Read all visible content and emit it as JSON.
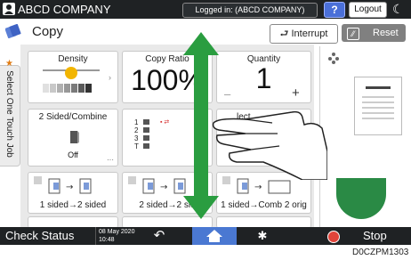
{
  "topbar": {
    "company": "ABCD COMPANY",
    "login_status": "Logged in: (ABCD COMPANY)",
    "help_label": "?",
    "logout_label": "Logout"
  },
  "header": {
    "title": "Copy",
    "interrupt_label": "Interrupt",
    "reset_label": "Reset"
  },
  "side_tab": {
    "label": "Select One Touch Job"
  },
  "tiles": {
    "density": {
      "label": "Density"
    },
    "copy_ratio": {
      "label": "Copy Ratio",
      "value": "100%"
    },
    "quantity": {
      "label": "Quantity",
      "value": "1",
      "minus": "–",
      "plus": "+"
    },
    "sided_combine": {
      "label": "2 Sided/Combine",
      "value": "Off"
    },
    "paper_select": {
      "items": [
        "1",
        "2",
        "3",
        "T"
      ]
    },
    "select_partial": {
      "label": "lect"
    },
    "presets": [
      {
        "label": "1 sided→2 sided"
      },
      {
        "label": "2 sided→2 sid"
      },
      {
        "label": "1 sided→Comb 2 orig"
      }
    ]
  },
  "bottombar": {
    "check_status": "Check Status",
    "date": "08 May 2020",
    "time": "10:48",
    "stop_label": "Stop"
  },
  "caption": "D0CZPM1303",
  "colors": {
    "arrow": "#2a9d40",
    "accent_blue": "#4a78d2",
    "help_blue": "#4a6fd8",
    "stop_red": "#e0443a"
  }
}
